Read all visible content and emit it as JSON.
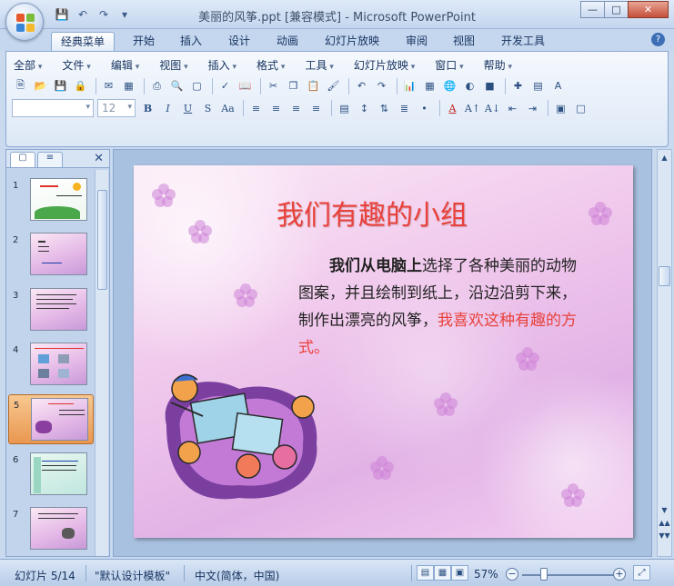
{
  "window": {
    "title": "美丽的风筝.ppt [兼容模式] - Microsoft PowerPoint",
    "controls": [
      "—",
      "□",
      "✕"
    ]
  },
  "quick_access": [
    "save-icon",
    "undo-icon",
    "redo-icon",
    "customize-icon"
  ],
  "ribbon_tabs": [
    "经典菜单",
    "开始",
    "插入",
    "设计",
    "动画",
    "幻灯片放映",
    "审阅",
    "视图",
    "开发工具"
  ],
  "active_tab": "经典菜单",
  "menus": [
    "全部",
    "文件",
    "编辑",
    "视图",
    "插入",
    "格式",
    "工具",
    "幻灯片放映",
    "窗口",
    "帮助"
  ],
  "font_size_value": "12",
  "format_buttons": [
    "B",
    "I",
    "U",
    "S",
    "Aa"
  ],
  "font_color_label": "A",
  "slides": [
    {
      "num": "1"
    },
    {
      "num": "2"
    },
    {
      "num": "3"
    },
    {
      "num": "4"
    },
    {
      "num": "5"
    },
    {
      "num": "6"
    },
    {
      "num": "7"
    }
  ],
  "selected_slide": "5",
  "slide": {
    "title": "我们有趣的小组",
    "body_bold": "我们从电脑上",
    "body_text": "选择了各种美丽的动物图案，并且绘制到纸上，沿边沿剪下来，制作出漂亮的风筝，",
    "body_highlight": "我喜欢这种有趣的方式。"
  },
  "status": {
    "slide_counter": "幻灯片 5/14",
    "template": "\"默认设计模板\"",
    "language": "中文(简体，中国)",
    "zoom": "57%"
  },
  "colors": {
    "title_red": "#e8413a",
    "ribbon_blue": "#c5d7ef",
    "selection_orange": "#e9974f"
  }
}
